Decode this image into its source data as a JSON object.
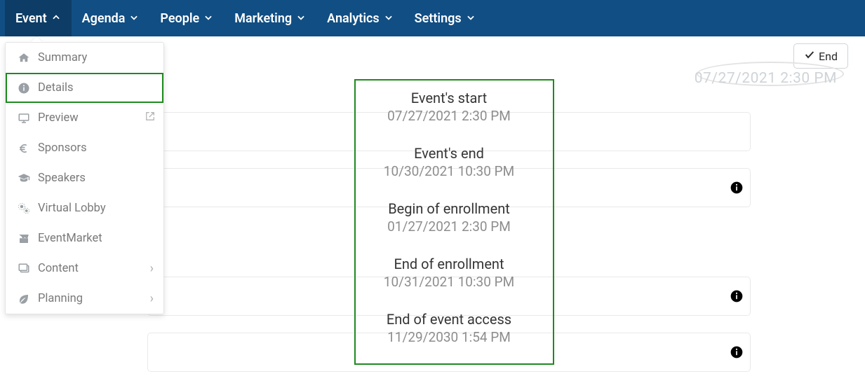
{
  "nav": {
    "items": [
      {
        "label": "Event",
        "open": true
      },
      {
        "label": "Agenda",
        "open": false
      },
      {
        "label": "People",
        "open": false
      },
      {
        "label": "Marketing",
        "open": false
      },
      {
        "label": "Analytics",
        "open": false
      },
      {
        "label": "Settings",
        "open": false
      }
    ]
  },
  "end_button": {
    "label": "End"
  },
  "dropdown": {
    "items": [
      {
        "icon": "home-icon",
        "label": "Summary"
      },
      {
        "icon": "info-circle-icon",
        "label": "Details",
        "selected": true
      },
      {
        "icon": "monitor-icon",
        "label": "Preview",
        "external": true
      },
      {
        "icon": "euro-icon",
        "label": "Sponsors"
      },
      {
        "icon": "grad-cap-icon",
        "label": "Speakers"
      },
      {
        "icon": "gears-icon",
        "label": "Virtual Lobby"
      },
      {
        "icon": "store-icon",
        "label": "EventMarket"
      },
      {
        "icon": "images-icon",
        "label": "Content",
        "submenu": true
      },
      {
        "icon": "leaf-icon",
        "label": "Planning",
        "submenu": true
      }
    ]
  },
  "event_dates": {
    "rows": [
      {
        "label": "Event's start",
        "value": "07/27/2021 2:30 PM"
      },
      {
        "label": "Event's end",
        "value": "10/30/2021 10:30 PM"
      },
      {
        "label": "Begin of enrollment",
        "value": "01/27/2021 2:30 PM"
      },
      {
        "label": "End of enrollment",
        "value": "10/31/2021 10:30 PM"
      },
      {
        "label": "End of event access",
        "value": "11/29/2030 1:54 PM"
      }
    ]
  },
  "faint_date": "07/27/2021 2:30 PM"
}
